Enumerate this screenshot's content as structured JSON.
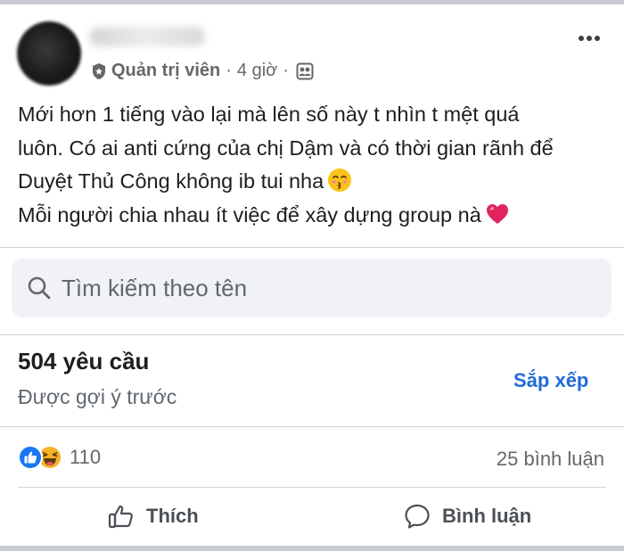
{
  "post": {
    "author_role": "Quản trị viên",
    "time": "4 giờ",
    "lines": [
      "Mới hơn 1 tiếng vào lại mà lên số này t nhìn t mệt quá",
      "luôn. Có ai anti cứng của chị Dậm và có thời gian rãnh để",
      "Duyệt Thủ Công không ib tui nha",
      "Mỗi người chia nhau ít việc để xây dựng group nà"
    ],
    "line3_emoji": "kissing-face-icon",
    "line4_emoji": "red-heart-icon"
  },
  "search": {
    "placeholder": "Tìm kiếm theo tên"
  },
  "requests": {
    "count_label": "504 yêu cầu",
    "subtitle": "Được gợi ý trước",
    "sort_label": "Sắp xếp"
  },
  "stats": {
    "reaction_count": "110",
    "comment_count": "25 bình luận"
  },
  "actions": {
    "like_label": "Thích",
    "comment_label": "Bình luận"
  },
  "colors": {
    "accent": "#1f6bd6",
    "secondary_text": "#65676b",
    "search_bg": "#f0f2f5",
    "like_blue": "#1877f2",
    "haha_yellow": "#f7b125",
    "heart_red": "#e0245e"
  }
}
